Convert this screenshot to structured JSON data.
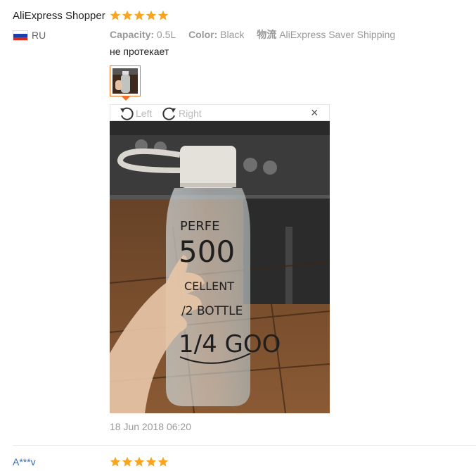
{
  "review1": {
    "user_name": "AliExpress Shopper",
    "stars": 5,
    "country": "RU",
    "flag_colors": [
      "#ffffff",
      "#1c3fb0",
      "#d52b1e"
    ],
    "meta": {
      "capacity_label": "Capacity:",
      "capacity_value": "0.5L",
      "color_label": "Color:",
      "color_value": "Black",
      "shipping_label": "物流",
      "shipping_value": "AliExpress Saver Shipping"
    },
    "text": "не протекает",
    "viewer": {
      "rotate_left_label": "Left",
      "rotate_right_label": "Right",
      "close_glyph": "×"
    },
    "photo_text": {
      "line1": "PERFE",
      "line2": "500",
      "line3": "CELLENT",
      "line4": "/2 BOTTLE",
      "line5": "1/4 GOO"
    },
    "date": "18 Jun 2018 06:20"
  },
  "review2": {
    "user_name": "A***v",
    "stars": 5
  },
  "colors": {
    "star": "#f6a623",
    "accent": "#f57224",
    "link": "#2a6ec7"
  }
}
